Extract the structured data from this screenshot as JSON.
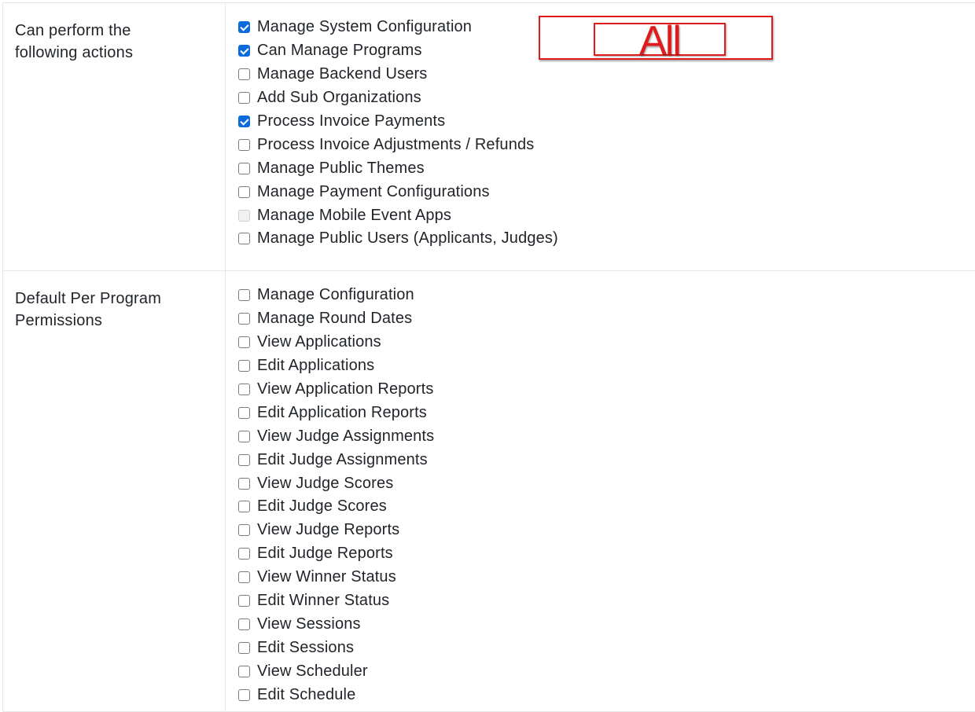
{
  "actions_section": {
    "label": "Can perform the following actions",
    "items": [
      {
        "label": "Manage System Configuration",
        "state": "checked"
      },
      {
        "label": "Can Manage Programs",
        "state": "checked"
      },
      {
        "label": "Manage Backend Users",
        "state": "unchecked"
      },
      {
        "label": "Add Sub Organizations",
        "state": "unchecked"
      },
      {
        "label": "Process Invoice Payments",
        "state": "checked"
      },
      {
        "label": "Process Invoice Adjustments / Refunds",
        "state": "unchecked"
      },
      {
        "label": "Manage Public Themes",
        "state": "unchecked"
      },
      {
        "label": "Manage Payment Configurations",
        "state": "unchecked"
      },
      {
        "label": "Manage Mobile Event Apps",
        "state": "disabled"
      },
      {
        "label": "Manage Public Users (Applicants, Judges)",
        "state": "unchecked"
      }
    ]
  },
  "defaults_section": {
    "label": "Default Per Program Permissions",
    "items": [
      {
        "label": "Manage Configuration",
        "state": "unchecked"
      },
      {
        "label": "Manage Round Dates",
        "state": "unchecked"
      },
      {
        "label": "View Applications",
        "state": "unchecked"
      },
      {
        "label": "Edit Applications",
        "state": "unchecked"
      },
      {
        "label": "View Application Reports",
        "state": "unchecked"
      },
      {
        "label": "Edit Application Reports",
        "state": "unchecked"
      },
      {
        "label": "View Judge Assignments",
        "state": "unchecked"
      },
      {
        "label": "Edit Judge Assignments",
        "state": "unchecked"
      },
      {
        "label": "View Judge Scores",
        "state": "unchecked"
      },
      {
        "label": "Edit Judge Scores",
        "state": "unchecked"
      },
      {
        "label": "View Judge Reports",
        "state": "unchecked"
      },
      {
        "label": "Edit Judge Reports",
        "state": "unchecked"
      },
      {
        "label": "View Winner Status",
        "state": "unchecked"
      },
      {
        "label": "Edit Winner Status",
        "state": "unchecked"
      },
      {
        "label": "View Sessions",
        "state": "unchecked"
      },
      {
        "label": "Edit Sessions",
        "state": "unchecked"
      },
      {
        "label": "View Scheduler",
        "state": "unchecked"
      },
      {
        "label": "Edit Schedule",
        "state": "unchecked"
      }
    ]
  },
  "annotation": {
    "text": "All",
    "color": "#e01b1b"
  },
  "colors": {
    "checkbox_checked": "#0b6bdc",
    "border": "#e6e6e6"
  }
}
